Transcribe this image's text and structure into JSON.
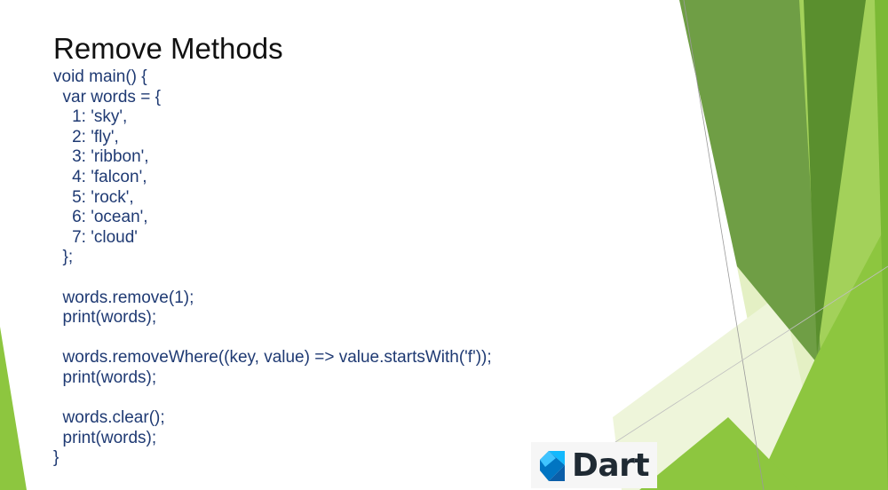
{
  "slide": {
    "title": "Remove Methods",
    "code_lines": [
      "void main() {",
      "  var words = {",
      "    1: 'sky',",
      "    2: 'fly',",
      "    3: 'ribbon',",
      "    4: 'falcon',",
      "    5: 'rock',",
      "    6: 'ocean',",
      "    7: 'cloud'",
      "  };",
      "",
      "  words.remove(1);",
      "  print(words);",
      "",
      "  words.removeWhere((key, value) => value.startsWith('f'));",
      "  print(words);",
      "",
      "  words.clear();",
      "  print(words);",
      "}"
    ],
    "logo_text": "Dart"
  },
  "colors": {
    "code_text": "#1f3a73",
    "title_text": "#111111",
    "accent_green": "#8dc63f",
    "dark_green": "#4f8f2a",
    "logo_blue": "#0175c2",
    "logo_cyan": "#13b9fd"
  }
}
